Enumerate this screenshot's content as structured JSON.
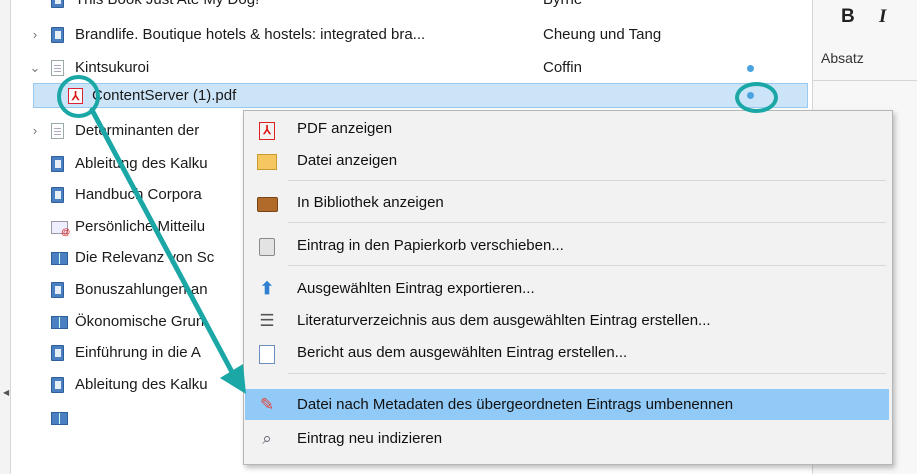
{
  "tree": {
    "rows": [
      {
        "title": "This Book Just Ate My Dog!",
        "creator": "Byrne",
        "icon": "book-icon"
      },
      {
        "title": "Brandlife. Boutique hotels & hostels: integrated bra...",
        "creator": "Cheung und Tang",
        "icon": "book-icon"
      },
      {
        "title": "Kintsukuroi",
        "creator": "Coffin",
        "icon": "document-icon"
      },
      {
        "title": "ContentServer (1).pdf",
        "creator": "",
        "icon": "pdf-icon"
      },
      {
        "title": "Determinanten der",
        "creator": "",
        "icon": "document-icon"
      },
      {
        "title": "Ableitung des Kalku",
        "creator": "",
        "icon": "book-icon"
      },
      {
        "title": "Handbuch Corpora",
        "creator": "",
        "icon": "book-icon"
      },
      {
        "title": "Persönliche Mitteilu",
        "creator": "",
        "icon": "email-icon"
      },
      {
        "title": "Die Relevanz von Sc",
        "creator": "",
        "icon": "book-section-icon"
      },
      {
        "title": "Bonuszahlungen an",
        "creator": "",
        "icon": "book-icon"
      },
      {
        "title": "Ökonomische Grun",
        "creator": "",
        "icon": "book-section-icon"
      },
      {
        "title": "Einführung in die A",
        "creator": "",
        "icon": "book-icon"
      },
      {
        "title": "Ableitung des Kalku",
        "creator": "",
        "icon": "book-icon"
      },
      {
        "title": "",
        "creator": "",
        "icon": "book-section-icon"
      }
    ]
  },
  "editor": {
    "bold_label": "B",
    "italic_label": "I",
    "paragraph_label": "Absatz"
  },
  "context_menu": {
    "items": [
      {
        "label": "PDF anzeigen",
        "icon": "pdf-icon"
      },
      {
        "label": "Datei anzeigen",
        "icon": "folder-icon"
      },
      {
        "label": "In Bibliothek anzeigen",
        "icon": "library-icon"
      },
      {
        "label": "Eintrag in den Papierkorb verschieben...",
        "icon": "trash-icon"
      },
      {
        "label": "Ausgewählten Eintrag exportieren...",
        "icon": "export-arrow-icon"
      },
      {
        "label": "Literaturverzeichnis aus dem ausgewählten Eintrag erstellen...",
        "icon": "list-icon"
      },
      {
        "label": "Bericht aus dem ausgewählten Eintrag erstellen...",
        "icon": "report-icon"
      },
      {
        "label": "Datei nach Metadaten des übergeordneten Eintrags umbenennen",
        "icon": "rename-pencil-icon"
      },
      {
        "label": "Eintrag neu indizieren",
        "icon": "reindex-icon"
      }
    ],
    "highlighted_index": 7
  },
  "colors": {
    "annotation": "#1aa7a6",
    "selection": "#cce4f7",
    "menu_highlight": "#91c9f7",
    "attachment_dot": "#4aa3df"
  }
}
